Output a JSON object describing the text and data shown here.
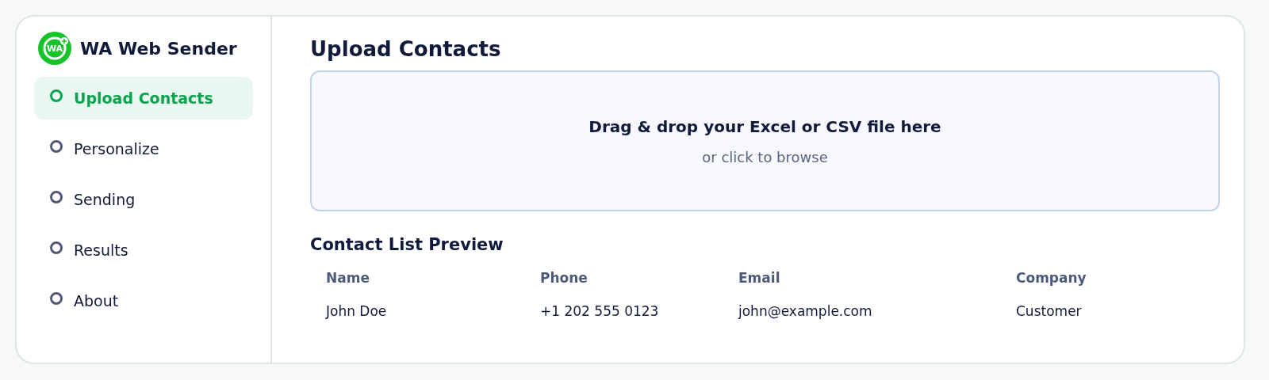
{
  "app": {
    "logo_text": "WA",
    "title": "WA Web Sender"
  },
  "sidebar": {
    "items": [
      {
        "label": "Upload Contacts",
        "selected": true
      },
      {
        "label": "Personalize",
        "selected": false
      },
      {
        "label": "Sending",
        "selected": false
      },
      {
        "label": "Results",
        "selected": false
      },
      {
        "label": "About",
        "selected": false
      }
    ]
  },
  "main": {
    "title": "Upload Contacts",
    "dropzone": {
      "heading": "Drag & drop your Excel or CSV file here",
      "hint": "or click to browse"
    },
    "preview": {
      "title": "Contact List Preview",
      "columns": [
        "Name",
        "Phone",
        "Email",
        "Company"
      ],
      "rows": [
        [
          "John Doe",
          "+1 202 555 0123",
          "john@example.com",
          "Customer"
        ]
      ]
    }
  }
}
